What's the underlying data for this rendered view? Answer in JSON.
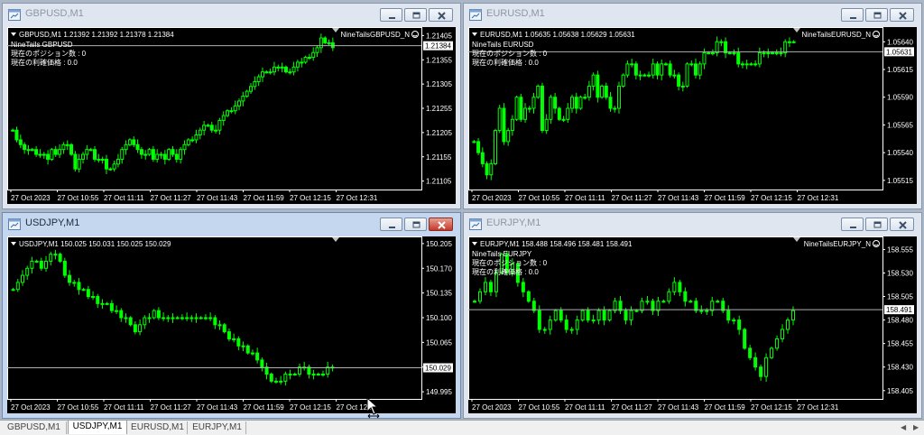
{
  "colors": {
    "background": "#000000",
    "grid_text": "#ffffff",
    "candle": "#00ff00",
    "bid_line": "#c0c0c0",
    "price_tag_bg": "#ffffff"
  },
  "windows": [
    {
      "id": "gbpusd",
      "title": "GBPUSD,M1",
      "active": false,
      "header": "GBPUSD,M1  1.21392 1.21392 1.21378 1.21384",
      "info": [
        "NineTails GBPUSD",
        "現在のポジション数 : 0",
        "現在の利確価格 : 0.0"
      ],
      "ea": "NineTailsGBPUSD_N",
      "price_tag": "1.21384",
      "price_ticks": [
        "1.21405",
        "1.21355",
        "1.21305",
        "1.21255",
        "1.21205",
        "1.21155",
        "1.21105"
      ],
      "time_ticks": [
        "27 Oct 2023",
        "27 Oct 10:55",
        "27 Oct 11:11",
        "27 Oct 11:27",
        "27 Oct 11:43",
        "27 Oct 11:59",
        "27 Oct 12:15",
        "27 Oct 12:31"
      ],
      "chart_data": {
        "type": "candlestick",
        "ylim": [
          1.21095,
          1.21415
        ],
        "last": 1.21384,
        "close": [
          1.2121,
          1.2119,
          1.2118,
          1.2117,
          1.2117,
          1.2117,
          1.2116,
          1.2116,
          1.2116,
          1.2115,
          1.2117,
          1.2116,
          1.2117,
          1.2118,
          1.2118,
          1.2116,
          1.2113,
          1.2115,
          1.2116,
          1.2117,
          1.2117,
          1.2115,
          1.2115,
          1.2115,
          1.2113,
          1.2113,
          1.2114,
          1.2115,
          1.2117,
          1.2118,
          1.2119,
          1.2118,
          1.2117,
          1.2116,
          1.2116,
          1.2117,
          1.2115,
          1.2116,
          1.2116,
          1.2115,
          1.2117,
          1.2116,
          1.2115,
          1.2117,
          1.2118,
          1.2119,
          1.2119,
          1.212,
          1.2121,
          1.2122,
          1.2122,
          1.2121,
          1.2121,
          1.2123,
          1.2124,
          1.2125,
          1.2125,
          1.2126,
          1.2127,
          1.2128,
          1.2129,
          1.213,
          1.2131,
          1.2132,
          1.2133,
          1.2133,
          1.2133,
          1.2134,
          1.2134,
          1.2134,
          1.2133,
          1.2133,
          1.2134,
          1.2135,
          1.2135,
          1.2136,
          1.2136,
          1.2137,
          1.2138,
          1.214,
          1.2139,
          1.2139,
          1.2138
        ]
      }
    },
    {
      "id": "eurusd",
      "title": "EURUSD,M1",
      "active": false,
      "header": "EURUSD,M1  1.05635 1.05638 1.05629 1.05631",
      "info": [
        "NineTails EURUSD",
        "現在のポジション数 : 0",
        "現在の利確価格 : 0.0"
      ],
      "ea": "NineTailsEURUSD_N",
      "price_tag": "1.05631",
      "price_ticks": [
        "1.05640",
        "1.05615",
        "1.05590",
        "1.05565",
        "1.05540",
        "1.05515"
      ],
      "time_ticks": [
        "27 Oct 2023",
        "27 Oct 10:55",
        "27 Oct 11:11",
        "27 Oct 11:27",
        "27 Oct 11:43",
        "27 Oct 11:59",
        "27 Oct 12:15",
        "27 Oct 12:31"
      ],
      "chart_data": {
        "type": "candlestick",
        "ylim": [
          1.0551,
          1.0565
        ],
        "last": 1.05631,
        "close": [
          1.0555,
          1.0554,
          1.0553,
          1.0552,
          1.0553,
          1.0556,
          1.0558,
          1.0555,
          1.0556,
          1.0557,
          1.0559,
          1.0557,
          1.0558,
          1.0558,
          1.0559,
          1.056,
          1.0556,
          1.0557,
          1.0559,
          1.0558,
          1.0557,
          1.0557,
          1.0558,
          1.0559,
          1.0558,
          1.0559,
          1.0559,
          1.056,
          1.0561,
          1.0559,
          1.056,
          1.0559,
          1.0558,
          1.0558,
          1.056,
          1.0561,
          1.0562,
          1.0562,
          1.0561,
          1.0561,
          1.0561,
          1.0561,
          1.0562,
          1.0561,
          1.0562,
          1.0562,
          1.0561,
          1.0561,
          1.056,
          1.056,
          1.0562,
          1.0562,
          1.0561,
          1.0562,
          1.0563,
          1.0563,
          1.0563,
          1.0564,
          1.0564,
          1.0563,
          1.0563,
          1.0563,
          1.0562,
          1.0562,
          1.0562,
          1.0562,
          1.0562,
          1.0563,
          1.0563,
          1.0563,
          1.0563,
          1.0563,
          1.0563,
          1.0564,
          1.0564,
          1.0564
        ]
      }
    },
    {
      "id": "usdjpy",
      "title": "USDJPY,M1",
      "active": true,
      "header": "USDJPY,M1  150.025 150.031 150.025 150.029",
      "info": [],
      "ea": "",
      "price_tag": "150.029",
      "price_ticks": [
        "150.205",
        "150.170",
        "150.135",
        "150.100",
        "150.065",
        "150.030",
        "149.995"
      ],
      "time_ticks": [
        "27 Oct 2023",
        "27 Oct 10:55",
        "27 Oct 11:11",
        "27 Oct 11:27",
        "27 Oct 11:43",
        "27 Oct 11:59",
        "27 Oct 12:15",
        "27 Oct 12:3"
      ],
      "chart_data": {
        "type": "candlestick",
        "ylim": [
          149.99,
          150.21
        ],
        "last": 150.029,
        "close": [
          150.14,
          150.15,
          150.16,
          150.17,
          150.18,
          150.18,
          150.17,
          150.18,
          150.19,
          150.19,
          150.18,
          150.16,
          150.15,
          150.15,
          150.14,
          150.14,
          150.13,
          150.13,
          150.12,
          150.12,
          150.12,
          150.11,
          150.11,
          150.1,
          150.1,
          150.09,
          150.08,
          150.09,
          150.1,
          150.1,
          150.11,
          150.1,
          150.1,
          150.1,
          150.1,
          150.1,
          150.1,
          150.1,
          150.1,
          150.1,
          150.1,
          150.1,
          150.1,
          150.09,
          150.09,
          150.08,
          150.07,
          150.07,
          150.06,
          150.06,
          150.05,
          150.05,
          150.04,
          150.03,
          150.02,
          150.01,
          150.01,
          150.01,
          150.02,
          150.02,
          150.02,
          150.03,
          150.03,
          150.02,
          150.02,
          150.02,
          150.02,
          150.03,
          150.03
        ]
      }
    },
    {
      "id": "eurjpy",
      "title": "EURJPY,M1",
      "active": false,
      "header": "EURJPY,M1  158.488 158.496 158.481 158.491",
      "info": [
        "NineTails EURJPY",
        "現在のポジション数 : 0",
        "現在の利確価格 : 0.0"
      ],
      "ea": "NineTailsEURJPY_N",
      "price_tag": "158.491",
      "price_ticks": [
        "158.555",
        "158.530",
        "158.505",
        "158.480",
        "158.455",
        "158.430",
        "158.405"
      ],
      "time_ticks": [
        "27 Oct 2023",
        "27 Oct 10:55",
        "27 Oct 11:11",
        "27 Oct 11:27",
        "27 Oct 11:43",
        "27 Oct 11:59",
        "27 Oct 12:15",
        "27 Oct 12:31"
      ],
      "chart_data": {
        "type": "candlestick",
        "ylim": [
          158.4,
          158.565
        ],
        "last": 158.491,
        "close": [
          158.5,
          158.51,
          158.52,
          158.51,
          158.53,
          158.55,
          158.53,
          158.54,
          158.52,
          158.51,
          158.5,
          158.49,
          158.47,
          158.47,
          158.48,
          158.49,
          158.48,
          158.47,
          158.47,
          158.48,
          158.49,
          158.48,
          158.48,
          158.49,
          158.48,
          158.49,
          158.5,
          158.49,
          158.48,
          158.49,
          158.49,
          158.5,
          158.5,
          158.49,
          158.5,
          158.5,
          158.51,
          158.52,
          158.51,
          158.5,
          158.5,
          158.49,
          158.49,
          158.49,
          158.5,
          158.5,
          158.49,
          158.48,
          158.48,
          158.47,
          158.45,
          158.44,
          158.43,
          158.42,
          158.44,
          158.45,
          158.46,
          158.47,
          158.48,
          158.49
        ]
      }
    }
  ],
  "tabs": [
    "GBPUSD,M1",
    "USDJPY,M1",
    "EURUSD,M1",
    "EURJPY,M1"
  ],
  "selected_tab": 1
}
